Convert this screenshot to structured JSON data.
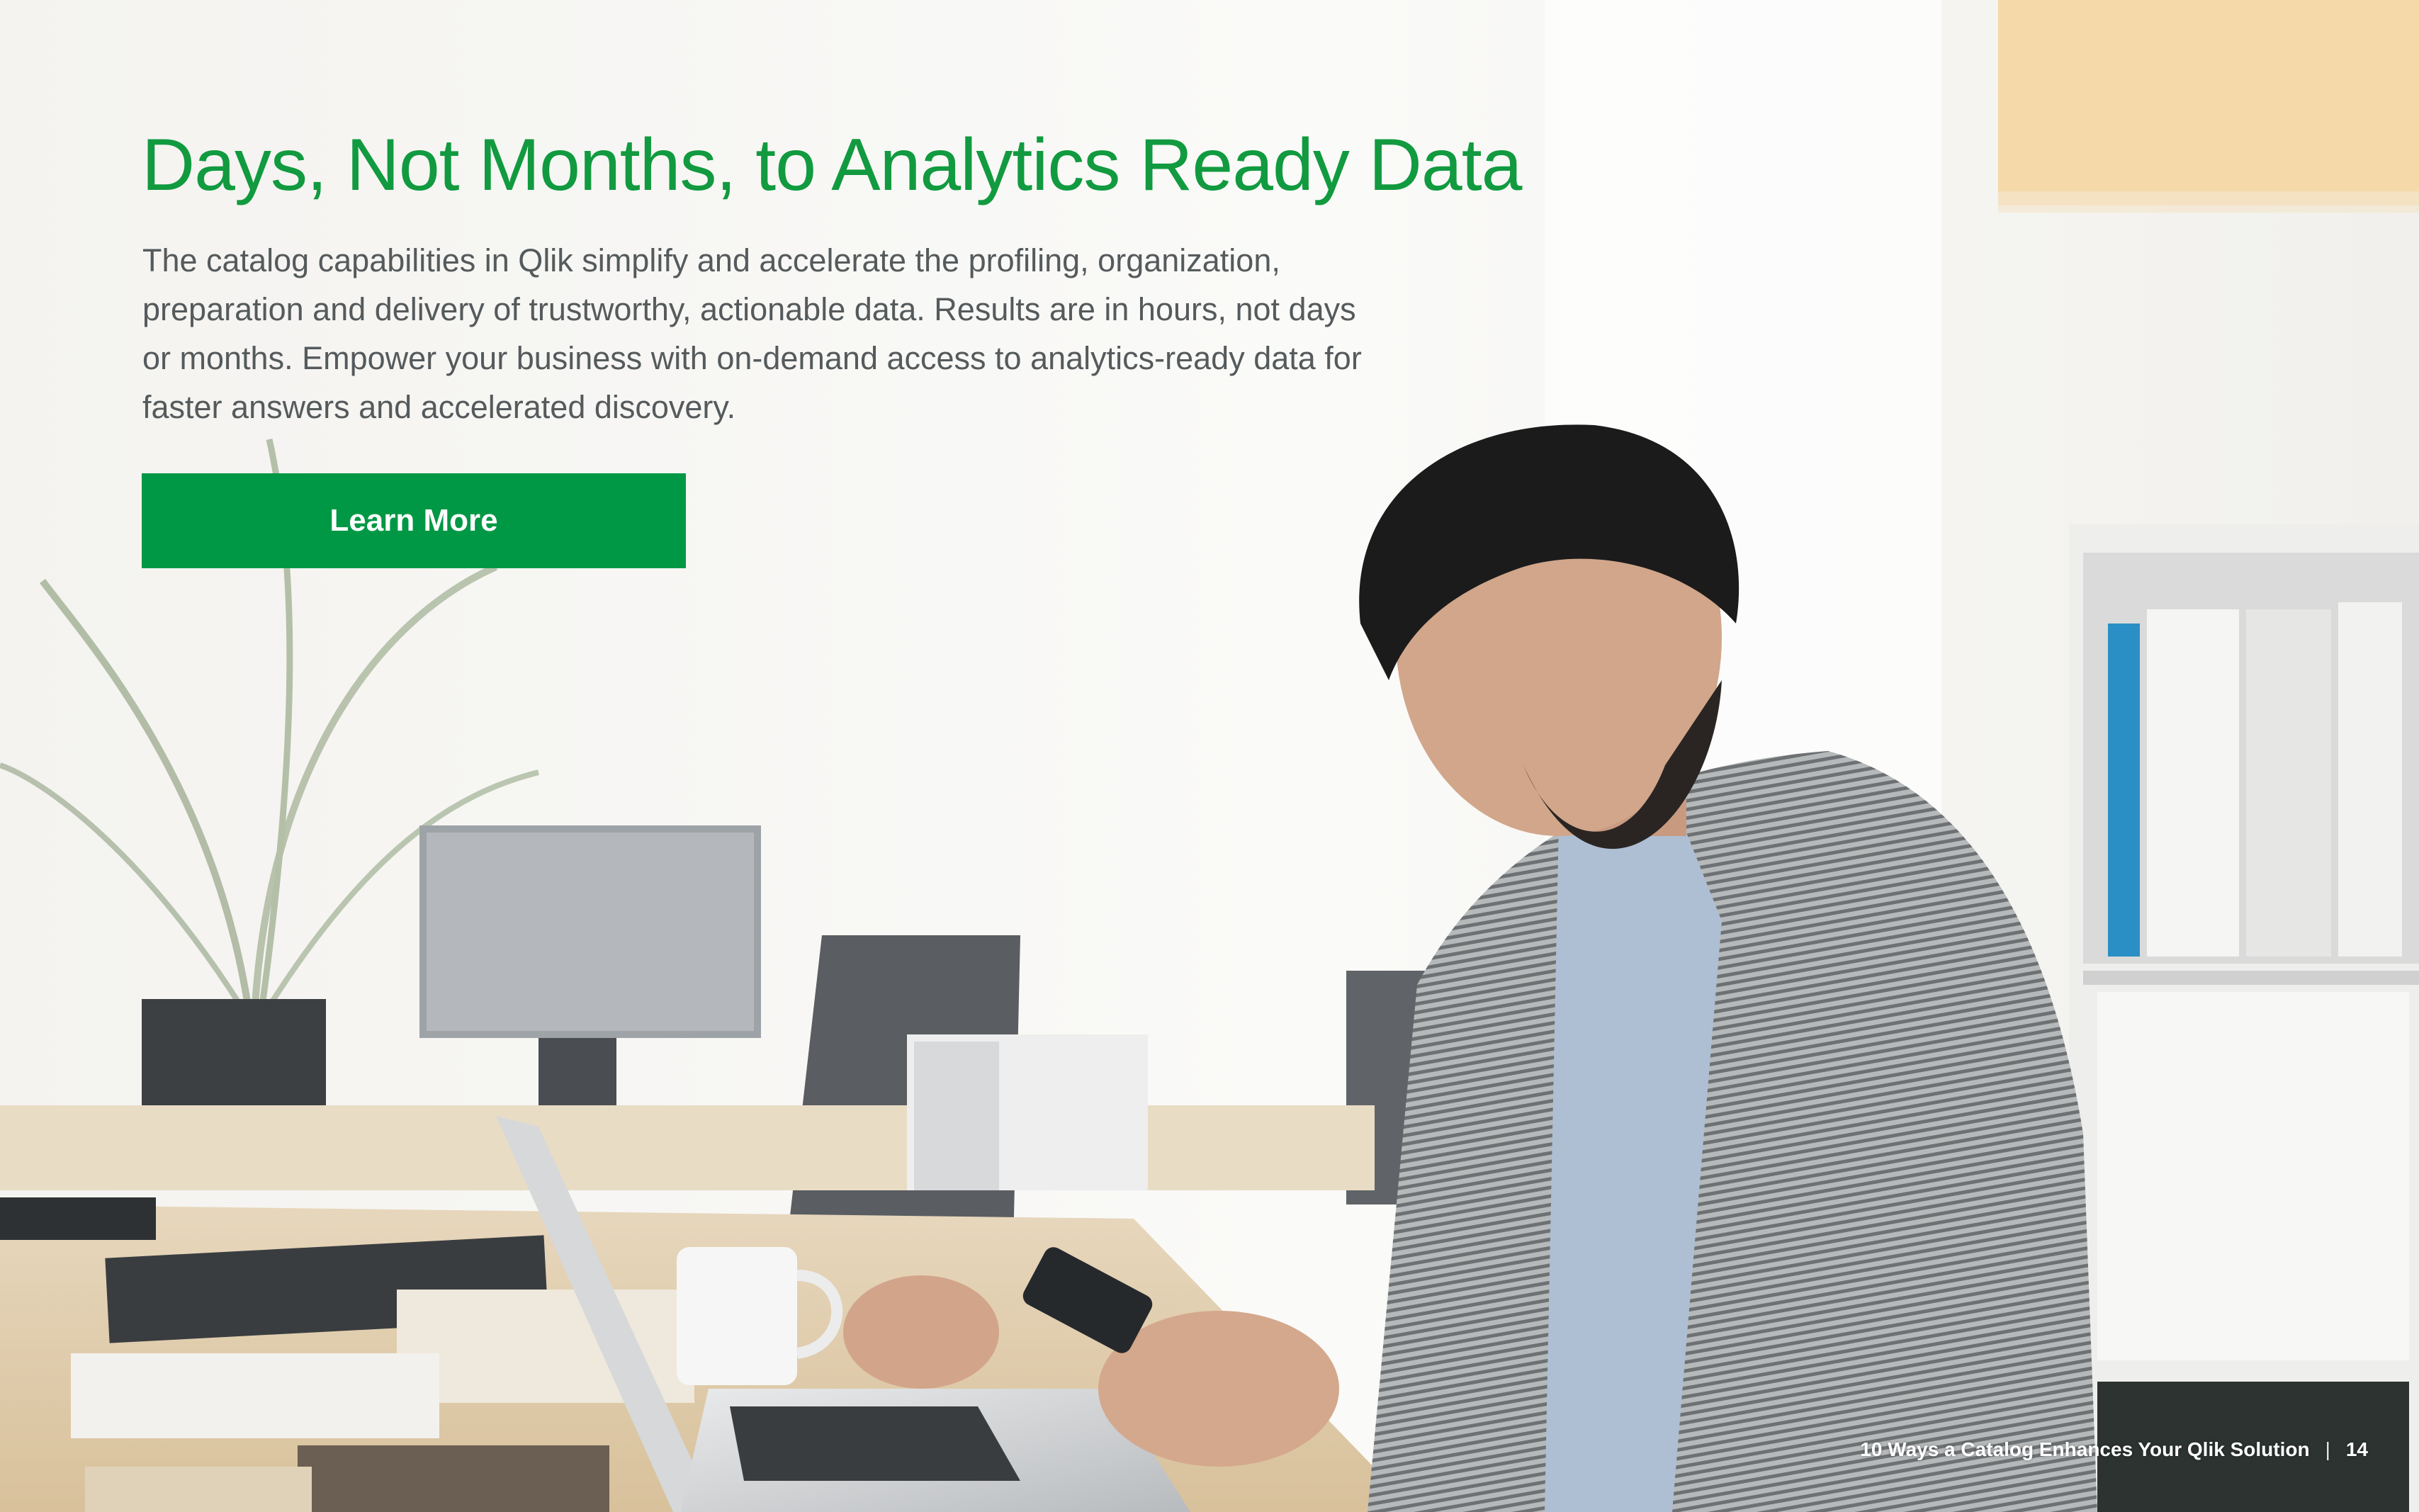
{
  "slide": {
    "headline": "Days, Not Months, to Analytics Ready Data",
    "body_lines": [
      "The catalog capabilities in Qlik simplify and accelerate the profiling, organization,",
      "preparation and delivery of trustworthy, actionable data. Results are in hours, not days",
      "or months. Empower your business with on-demand access to analytics-ready data for",
      "faster answers and accelerated discovery."
    ],
    "cta_label": "Learn More"
  },
  "footer": {
    "document_title": "10 Ways a Catalog Enhances Your Qlik Solution",
    "separator": "|",
    "page_number": "14"
  },
  "colors": {
    "headline": "#119a3f",
    "cta_background": "#009845",
    "body_text": "#555a5c"
  }
}
